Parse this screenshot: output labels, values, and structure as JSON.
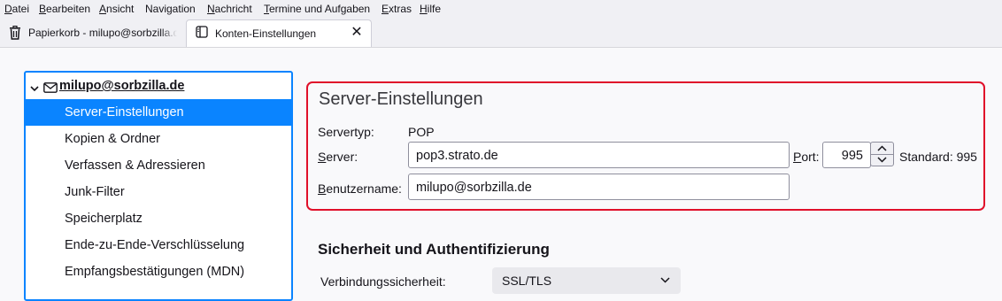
{
  "menubar": {
    "items": [
      {
        "mnemonic": "D",
        "rest": "atei"
      },
      {
        "mnemonic": "B",
        "rest": "earbeiten"
      },
      {
        "mnemonic": "A",
        "rest": "nsicht"
      },
      {
        "mnemonic": "",
        "rest": "Navigation"
      },
      {
        "mnemonic": "N",
        "rest": "achricht"
      },
      {
        "mnemonic": "T",
        "rest": "ermine und Aufgaben"
      },
      {
        "mnemonic": "E",
        "rest": "xtras"
      },
      {
        "mnemonic": "H",
        "rest": "ilfe"
      }
    ]
  },
  "tabs": [
    {
      "label": "Papierkorb - milupo@sorbzilla.de",
      "icon": "trash-icon"
    },
    {
      "label": "Konten-Einstellungen",
      "icon": "account-settings-icon",
      "close": "✕"
    }
  ],
  "tree": {
    "account": "milupo@sorbzilla.de",
    "items": [
      "Server-Einstellungen",
      "Kopien & Ordner",
      "Verfassen & Adressieren",
      "Junk-Filter",
      "Speicherplatz",
      "Ende-zu-Ende-Verschlüsselung",
      "Empfangsbestätigungen (MDN)"
    ],
    "selected_index": 0
  },
  "server": {
    "title": "Server-Einstellungen",
    "type_label": "Servertyp:",
    "type_value": "POP",
    "server_label_mn": "S",
    "server_label_rest": "erver:",
    "server_value": "pop3.strato.de",
    "port_label_mn": "P",
    "port_label_rest": "ort:",
    "port_value": "995",
    "standard_label": "Standard: 995",
    "user_label_mn": "B",
    "user_label_rest": "enutzername:",
    "user_value": "milupo@sorbzilla.de"
  },
  "security": {
    "heading": "Sicherheit und Authentifizierung",
    "connection_label": "Verbindungssicherheit:",
    "connection_value": "SSL/TLS"
  },
  "colors": {
    "accent": "#0a84ff",
    "highlight_border": "#e0102a"
  }
}
